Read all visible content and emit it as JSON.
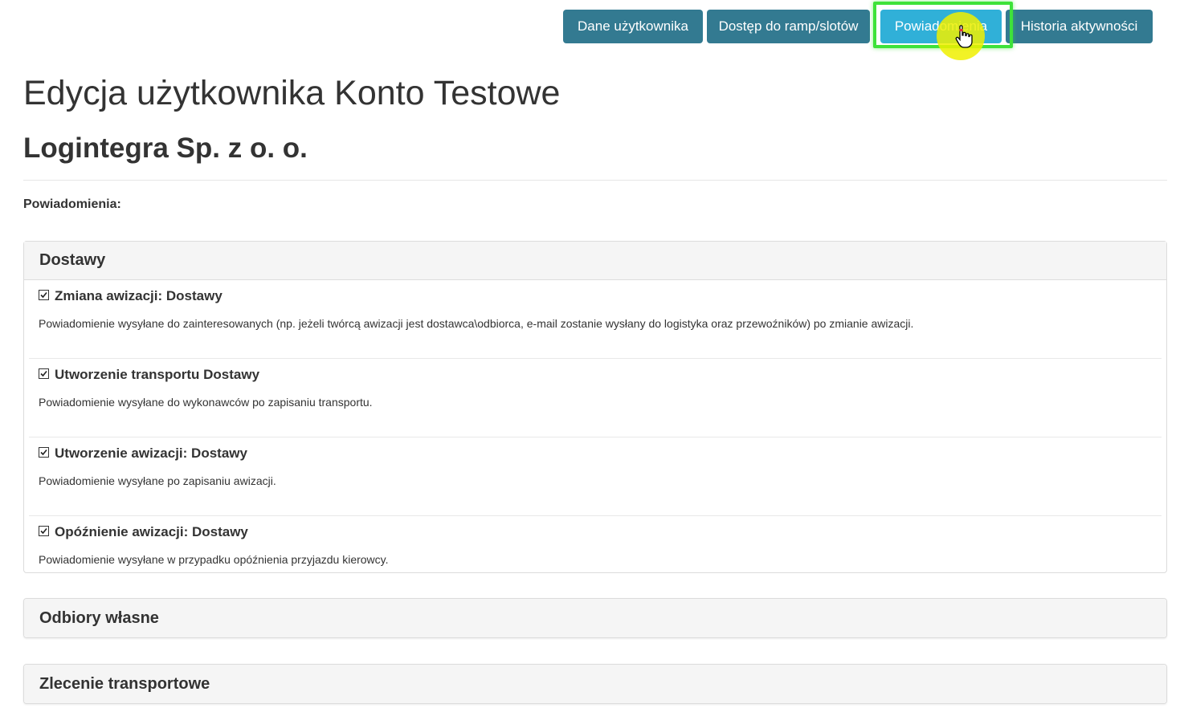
{
  "tabs": [
    {
      "label": "Dane użytkownika",
      "active": false
    },
    {
      "label": "Dostęp do ramp/slotów",
      "active": false
    },
    {
      "label": "Powiadomienia",
      "active": true
    },
    {
      "label": "Historia aktywności",
      "active": false
    }
  ],
  "page_title": "Edycja użytkownika Konto Testowe",
  "company": "Logintegra Sp. z o. o.",
  "section_label": "Powiadomienia:",
  "panels": [
    {
      "title": "Dostawy",
      "expanded": true,
      "items": [
        {
          "checked": true,
          "title": "Zmiana awizacji: Dostawy",
          "description": "Powiadomienie wysyłane do zainteresowanych (np. jeżeli twórcą awizacji jest dostawca\\odbiorca, e-mail zostanie wysłany do logistyka oraz przewoźników) po zmianie awizacji."
        },
        {
          "checked": true,
          "title": "Utworzenie transportu Dostawy",
          "description": "Powiadomienie wysyłane do wykonawców po zapisaniu transportu."
        },
        {
          "checked": true,
          "title": "Utworzenie awizacji: Dostawy",
          "description": "Powiadomienie wysyłane po zapisaniu awizacji."
        },
        {
          "checked": true,
          "title": "Opóźnienie awizacji: Dostawy",
          "description": "Powiadomienie wysyłane w przypadku opóźnienia przyjazdu kierowcy."
        }
      ]
    },
    {
      "title": "Odbiory własne",
      "expanded": false
    },
    {
      "title": "Zlecenie transportowe",
      "expanded": false
    }
  ],
  "colors": {
    "tab_default": "#337a91",
    "tab_active": "#30b0d8",
    "highlight": "#3ee23a",
    "click_indicator": "#f0f000"
  },
  "icons": {
    "checkbox": "check-box-icon",
    "cursor": "hand-pointer-icon"
  }
}
